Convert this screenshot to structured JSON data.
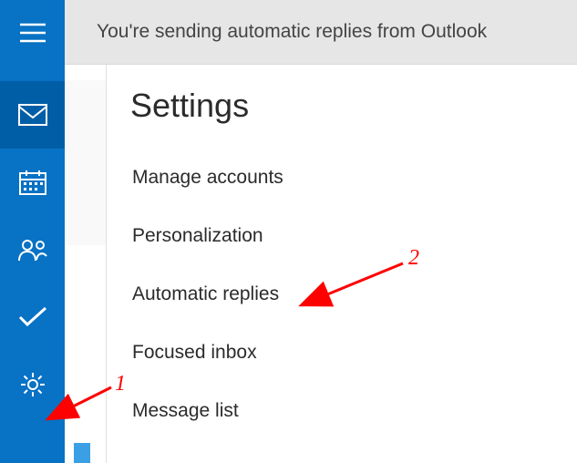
{
  "banner": {
    "text": "You're sending automatic replies from Outlook"
  },
  "sidebar": {
    "items": [
      {
        "name": "hamburger-menu-icon"
      },
      {
        "name": "mail-icon"
      },
      {
        "name": "calendar-icon"
      },
      {
        "name": "people-icon"
      },
      {
        "name": "check-icon"
      },
      {
        "name": "gear-icon"
      }
    ]
  },
  "panel": {
    "title": "Settings",
    "items": [
      "Manage accounts",
      "Personalization",
      "Automatic replies",
      "Focused inbox",
      "Message list"
    ]
  },
  "annotations": {
    "label1": "1",
    "label2": "2"
  }
}
